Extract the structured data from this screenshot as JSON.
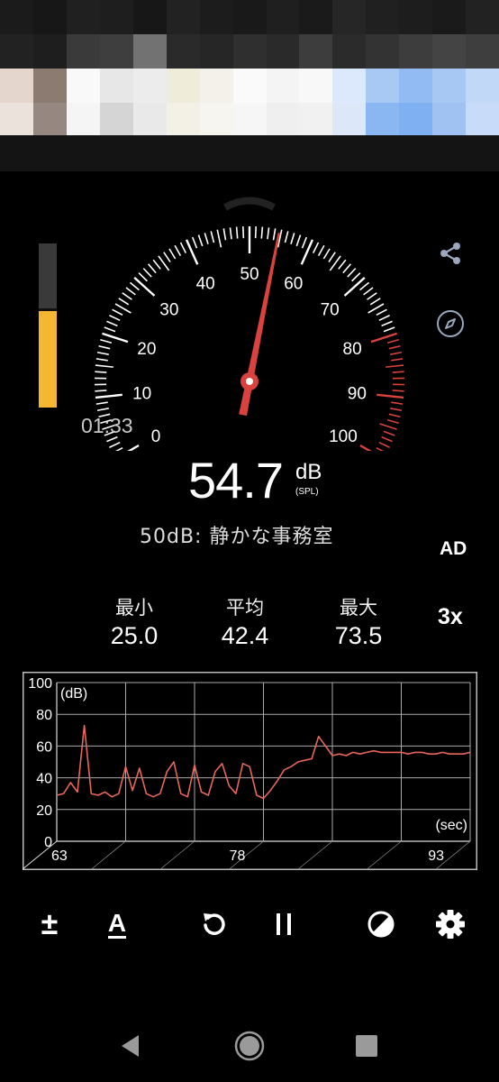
{
  "meter": {
    "timer": "01:33",
    "value": "54.7",
    "unit": "dB",
    "unit_sub": "(SPL)",
    "level_fraction": 0.59,
    "gauge_labels": [
      "0",
      "10",
      "20",
      "30",
      "40",
      "50",
      "60",
      "70",
      "80",
      "90",
      "100"
    ],
    "needle_value": 54.7,
    "description": "50dB: 静かな事務室",
    "ad_label": "AD",
    "speed_label": "3x"
  },
  "stats": {
    "min_label": "最小",
    "min_value": "25.0",
    "avg_label": "平均",
    "avg_value": "42.4",
    "max_label": "最大",
    "max_value": "73.5"
  },
  "chart_data": {
    "type": "line",
    "ylabel": "(dB)",
    "xlabel": "(sec)",
    "ylim": [
      0,
      100
    ],
    "xlim": [
      63,
      93
    ],
    "y_ticks": [
      "0",
      "20",
      "40",
      "60",
      "80",
      "100"
    ],
    "x_ticks": [
      "63",
      "78",
      "93"
    ],
    "x": [
      63,
      63.5,
      64,
      64.5,
      65,
      65.5,
      66,
      66.5,
      67,
      67.5,
      68,
      68.5,
      69,
      69.5,
      70,
      70.5,
      71,
      71.5,
      72,
      72.5,
      73,
      73.5,
      74,
      74.5,
      75,
      75.5,
      76,
      76.5,
      77,
      77.5,
      78,
      78.5,
      79,
      79.5,
      80,
      80.5,
      81,
      81.5,
      82,
      82.5,
      83,
      83.5,
      84,
      84.5,
      85,
      85.5,
      86,
      86.5,
      87,
      87.5,
      88,
      88.5,
      89,
      89.5,
      90,
      90.5,
      91,
      91.5,
      92,
      92.5,
      93
    ],
    "series": [
      {
        "values": [
          29,
          30,
          37,
          31,
          73,
          30,
          29,
          31,
          28,
          30,
          47,
          32,
          46,
          30,
          28,
          30,
          44,
          50,
          30,
          28,
          48,
          31,
          29,
          44,
          49,
          35,
          30,
          49,
          47,
          29,
          27,
          32,
          38,
          45,
          47,
          50,
          51,
          52,
          66,
          60,
          54,
          55,
          54,
          56,
          55,
          56,
          57,
          56,
          56,
          56,
          56,
          55,
          56,
          56,
          55,
          55,
          56,
          55,
          55,
          55,
          56
        ]
      }
    ],
    "line_color": "#e8665c",
    "grid": true
  },
  "toolbar": {
    "calibrate": "±",
    "weighting": "A"
  },
  "colors": {
    "accent_red": "#d9423d",
    "level_yellow": "#f5b731",
    "chart_line": "#e8665c"
  }
}
